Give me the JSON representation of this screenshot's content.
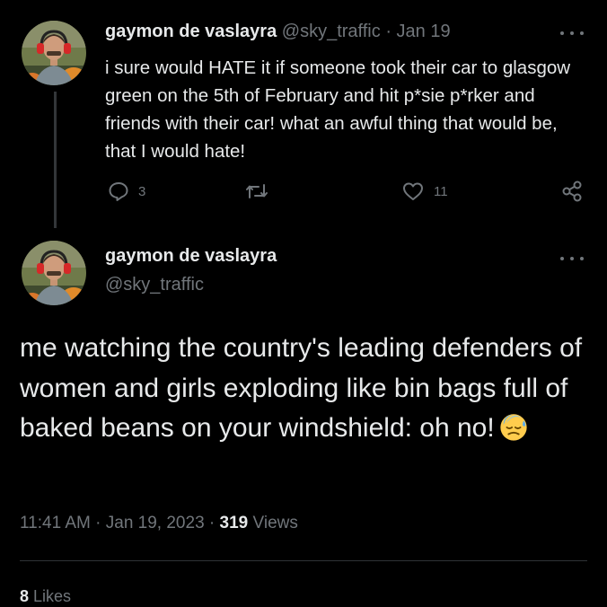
{
  "tweet1": {
    "display_name": "gaymon de vaslayra",
    "handle": "@sky_traffic",
    "separator": "·",
    "date": "Jan 19",
    "text": "i sure would HATE it if someone took their car to glasgow green on the 5th of February and hit p*sie p*rker and friends with their car! what an awful thing that would be, that I would hate!",
    "actions": {
      "reply_count": "3",
      "retweet_count": "",
      "like_count": "11"
    }
  },
  "tweet2": {
    "display_name": "gaymon de vaslayra",
    "handle": "@sky_traffic",
    "text": "me watching the country's leading defenders of women and girls exploding like bin bags full of baked beans on your windshield: oh no!",
    "emoji": "downcast-face-with-sweat",
    "time": "11:41 AM",
    "meta_separator": "·",
    "date": "Jan 19, 2023",
    "views_count": "319",
    "views_label": "Views",
    "likes_count": "8",
    "likes_label": "Likes"
  },
  "colors": {
    "background": "#000000",
    "text_primary": "#e7e9ea",
    "text_secondary": "#71767b",
    "divider": "#2f3336",
    "thread_line": "#333639"
  }
}
